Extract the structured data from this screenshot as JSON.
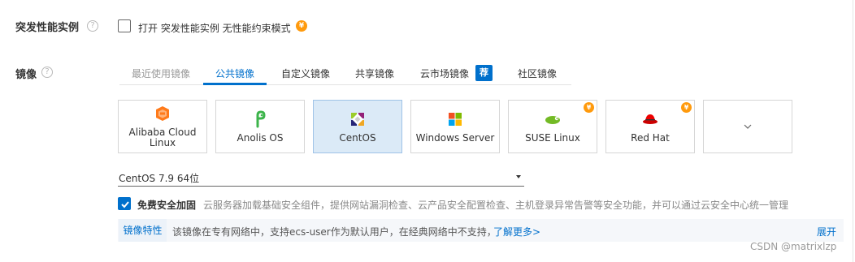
{
  "burst": {
    "label": "突发性能实例",
    "checkbox_label": "打开 突发性能实例 无性能约束模式",
    "checked": false,
    "price_badge": "¥"
  },
  "image": {
    "label": "镜像",
    "help_icon": "?",
    "tabs": [
      {
        "label": "最近使用镜像",
        "state": "disabled"
      },
      {
        "label": "公共镜像",
        "state": "active"
      },
      {
        "label": "自定义镜像",
        "state": "normal"
      },
      {
        "label": "共享镜像",
        "state": "normal"
      },
      {
        "label": "云市场镜像",
        "state": "normal",
        "badge": "荐"
      },
      {
        "label": "社区镜像",
        "state": "normal"
      }
    ],
    "os_cards": [
      {
        "name": "Alibaba Cloud Linux",
        "icon": "alibaba-cloud-icon",
        "paid": false,
        "selected": false
      },
      {
        "name": "Anolis OS",
        "icon": "anolis-icon",
        "paid": false,
        "selected": false
      },
      {
        "name": "CentOS",
        "icon": "centos-icon",
        "paid": false,
        "selected": true
      },
      {
        "name": "Windows Server",
        "icon": "windows-icon",
        "paid": false,
        "selected": false
      },
      {
        "name": "SUSE Linux",
        "icon": "suse-icon",
        "paid": true,
        "selected": false
      },
      {
        "name": "Red Hat",
        "icon": "redhat-icon",
        "paid": true,
        "selected": false
      },
      {
        "name": "",
        "icon": "chevron-down-icon",
        "paid": false,
        "selected": false
      }
    ],
    "paid_badge": "¥",
    "version": "CentOS 7.9 64位",
    "security": {
      "checked": true,
      "label": "免费安全加固",
      "description": "云服务器加载基础安全组件，提供网站漏洞检查、云产品安全配置检查、主机登录异常告警等安全功能，并可以通过云安全中心统一管理"
    },
    "feature": {
      "label": "镜像特性",
      "text": "该镜像在专有网络中，支持ecs-user作为默认用户，在经典网络中不支持，",
      "link": "了解更多>",
      "expand": "展开"
    }
  },
  "colors": {
    "accent": "#0070cc",
    "coin": "#ff9a0d",
    "selected_card": "#dbeaf7"
  },
  "watermark": "CSDN @matrixlzp"
}
